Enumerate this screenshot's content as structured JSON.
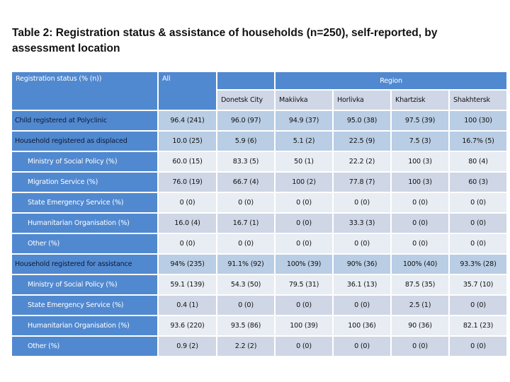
{
  "title": "Table 2: Registration status & assistance of households (n=250), self-reported, by assessment location",
  "table": {
    "header": {
      "row_label": "Registration status (% (n))",
      "all_label": "All",
      "region_label": "Region",
      "regions": [
        "Donetsk City",
        "Makiivka",
        "Horlivka",
        "Khartzisk",
        "Shakhtersk"
      ]
    },
    "rows": [
      {
        "label": "Child registered at Polyclinic",
        "level": "main",
        "values": [
          "96.4 (241)",
          "96.0 (97)",
          "94.9 (37)",
          "95.0 (38)",
          "97.5 (39)",
          "100 (30)"
        ]
      },
      {
        "label": "Household registered as displaced",
        "level": "main",
        "values": [
          "10.0 (25)",
          "5.9 (6)",
          "5.1 (2)",
          "22.5 (9)",
          "7.5 (3)",
          "16.7% (5)"
        ]
      },
      {
        "label": "Ministry of Social Policy (%)",
        "level": "sub",
        "values": [
          "60.0 (15)",
          "83.3 (5)",
          "50 (1)",
          "22.2 (2)",
          "100 (3)",
          "80 (4)"
        ]
      },
      {
        "label": "Migration Service (%)",
        "level": "sub",
        "values": [
          "76.0 (19)",
          "66.7 (4)",
          "100 (2)",
          "77.8 (7)",
          "100 (3)",
          "60 (3)"
        ]
      },
      {
        "label": "State Emergency Service (%)",
        "level": "sub",
        "values": [
          "0 (0)",
          "0 (0)",
          "0 (0)",
          "0 (0)",
          "0 (0)",
          "0 (0)"
        ]
      },
      {
        "label": "Humanitarian Organisation (%)",
        "level": "sub",
        "values": [
          "16.0 (4)",
          "16.7 (1)",
          "0 (0)",
          "33.3 (3)",
          "0 (0)",
          "0 (0)"
        ]
      },
      {
        "label": "Other (%)",
        "level": "sub",
        "values": [
          "0 (0)",
          "0 (0)",
          "0 (0)",
          "0 (0)",
          "0 (0)",
          "0 (0)"
        ]
      },
      {
        "label": "Household registered for assistance",
        "level": "main",
        "values": [
          "94% (235)",
          "91.1% (92)",
          "100% (39)",
          "90% (36)",
          "100% (40)",
          "93.3% (28)"
        ]
      },
      {
        "label": "Ministry of Social Policy (%)",
        "level": "sub",
        "values": [
          "59.1 (139)",
          "54.3 (50)",
          "79.5 (31)",
          "36.1 (13)",
          "87.5 (35)",
          "35.7 (10)"
        ]
      },
      {
        "label": "State Emergency Service (%)",
        "level": "sub",
        "values": [
          "0.4 (1)",
          "0 (0)",
          "0 (0)",
          "0 (0)",
          "2.5 (1)",
          "0 (0)"
        ]
      },
      {
        "label": "Humanitarian Organisation (%)",
        "level": "sub",
        "values": [
          "93.6 (220)",
          "93.5 (86)",
          "100 (39)",
          "100 (36)",
          "90 (36)",
          "82.1 (23)"
        ]
      },
      {
        "label": "Other (%)",
        "level": "sub",
        "values": [
          "0.9 (2)",
          "2.2 (2)",
          "0 (0)",
          "0 (0)",
          "0 (0)",
          "0 (0)"
        ]
      }
    ]
  }
}
